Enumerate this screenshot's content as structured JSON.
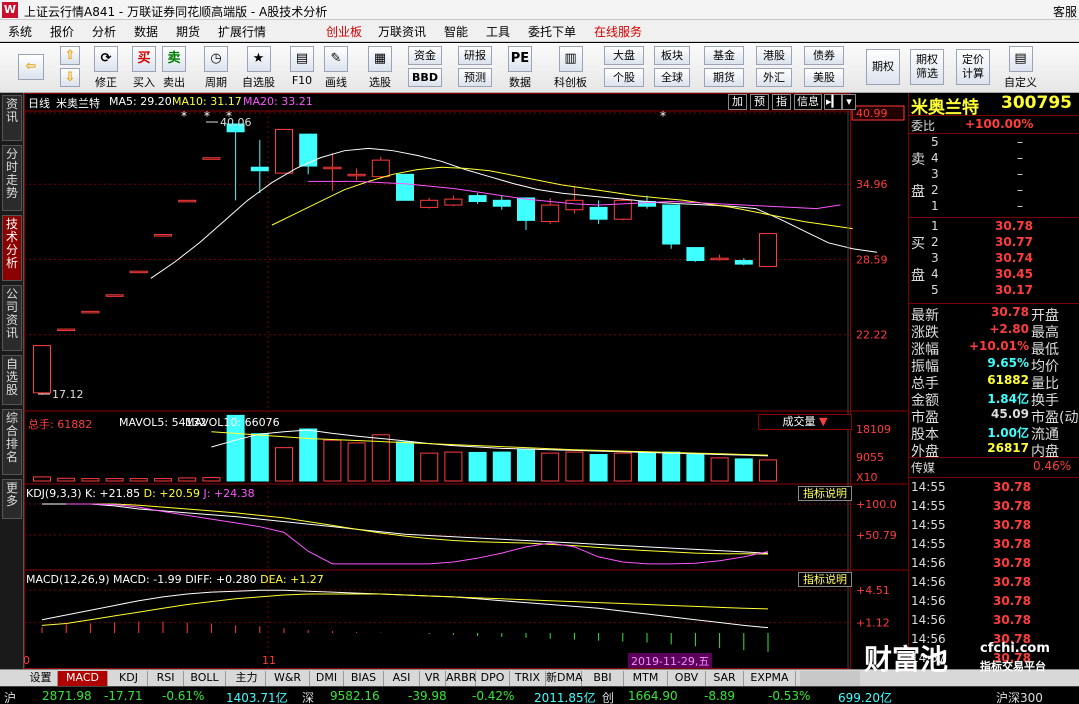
{
  "title_bar": {
    "logo": "W",
    "title": "上证云行情A841 - 万联证券同花顺高端版 - A股技术分析",
    "right_text": "客服"
  },
  "menu": [
    "系统",
    "报价",
    "分析",
    "数据",
    "期货",
    "扩展行情",
    "创业板",
    "万联资讯",
    "智能",
    "工具",
    "委托下单",
    "在线服务"
  ],
  "menu_highlight": [
    "创业板",
    "在线服务"
  ],
  "toolbar": {
    "big_buttons": [
      {
        "label": "修正",
        "icon": "refresh-icon",
        "glyph": "⟳"
      },
      {
        "label": "买入",
        "icon": "buy-icon",
        "glyph": "买"
      },
      {
        "label": "卖出",
        "icon": "sell-icon",
        "glyph": "卖"
      },
      {
        "label": "周期",
        "icon": "clock-icon",
        "glyph": "◷"
      },
      {
        "label": "自选股",
        "icon": "star-icon",
        "glyph": "★"
      },
      {
        "label": "F10",
        "icon": "f10-icon",
        "glyph": "▤"
      },
      {
        "label": "画线",
        "icon": "pencil-icon",
        "glyph": "✎"
      },
      {
        "label": "选股",
        "icon": "screen-icon",
        "glyph": "▦"
      },
      {
        "label": "数据",
        "icon": "pe-icon",
        "glyph": "PE"
      },
      {
        "label": "科创板",
        "icon": "kcb-icon",
        "glyph": "▥"
      },
      {
        "label": "期权",
        "icon": "option-icon",
        "glyph": ""
      },
      {
        "label": "期权筛选",
        "icon": "option-filter-icon",
        "glyph": ""
      },
      {
        "label": "定价计算",
        "icon": "calc-icon",
        "glyph": ""
      },
      {
        "label": "自定义",
        "icon": "custom-icon",
        "glyph": "▤"
      }
    ],
    "small_buttons": [
      "资金",
      "BBD",
      "研报",
      "预测",
      "大盘",
      "个股",
      "板块",
      "全球",
      "基金",
      "期货",
      "港股",
      "外汇",
      "债券",
      "美股"
    ]
  },
  "left_tabs": [
    "资讯",
    "分时走势",
    "技术分析",
    "公司资讯",
    "自选股",
    "综合排名",
    "更多"
  ],
  "chart": {
    "period": "日线",
    "name": "米奥兰特",
    "ma_label": [
      "MA5: 29.20",
      "MA10: 31.17",
      "MA20: 33.21"
    ],
    "ma_colors": {
      "ma5": "#ffffff",
      "ma10": "#ffff33",
      "ma20": "#ff55ff"
    },
    "up_color": "#ff3d3d",
    "down_color": "#40ffff",
    "panel_buttons": [
      "加",
      "预",
      "指",
      "信息"
    ],
    "price_axis": [
      "40.99",
      "34.96",
      "28.59",
      "22.22"
    ],
    "high_mark": "40.06",
    "low_mark": "17.12",
    "volume_header": [
      "总手: 61882",
      "MAVOL5: 54132",
      "MAVOL10: 66076"
    ],
    "volume_select": "成交量",
    "volume_axis": [
      "18109",
      "9055",
      "X10"
    ],
    "kdj_header": [
      "KDJ(9,3,3)",
      "K: +21.85",
      "D: +20.59",
      "J: +24.38"
    ],
    "kdj_axis": [
      "+100.0",
      "+50.79"
    ],
    "macd_header": [
      "MACD(12,26,9)",
      "MACD: -1.99",
      "DIFF: +0.280",
      "DEA: +1.27"
    ],
    "macd_axis": [
      "+4.51",
      "+1.12"
    ],
    "indicator_btn": "指标说明",
    "x_labels": [
      "10",
      "11"
    ],
    "date_label": "2019-11-29,五",
    "candles": [
      {
        "o": 17.3,
        "c": 21.3,
        "h": 21.3,
        "l": 17.12,
        "v": 12
      },
      {
        "o": 22.7,
        "c": 22.7,
        "h": 22.7,
        "l": 22.7,
        "v": 8
      },
      {
        "o": 24.2,
        "c": 24.2,
        "h": 24.2,
        "l": 24.2,
        "v": 7
      },
      {
        "o": 25.6,
        "c": 25.6,
        "h": 25.6,
        "l": 25.6,
        "v": 7
      },
      {
        "o": 27.6,
        "c": 27.6,
        "h": 27.6,
        "l": 27.6,
        "v": 7
      },
      {
        "o": 30.7,
        "c": 30.7,
        "h": 30.7,
        "l": 30.7,
        "v": 7
      },
      {
        "o": 33.6,
        "c": 33.6,
        "h": 33.6,
        "l": 33.6,
        "v": 9
      },
      {
        "o": 37.2,
        "c": 37.2,
        "h": 37.2,
        "l": 37.2,
        "v": 10
      },
      {
        "o": 40.06,
        "c": 39.4,
        "h": 40.06,
        "l": 33.6,
        "v": 193
      },
      {
        "o": 36.4,
        "c": 36.1,
        "h": 38.7,
        "l": 34.2,
        "v": 139
      },
      {
        "o": 35.9,
        "c": 39.6,
        "h": 39.6,
        "l": 35.9,
        "v": 98
      },
      {
        "o": 39.2,
        "c": 36.5,
        "h": 39.2,
        "l": 35.8,
        "v": 153
      },
      {
        "o": 36.4,
        "c": 36.4,
        "h": 37.6,
        "l": 34.4,
        "v": 120
      },
      {
        "o": 35.8,
        "c": 35.8,
        "h": 36.3,
        "l": 35.3,
        "v": 112
      },
      {
        "o": 35.6,
        "c": 37.0,
        "h": 37.3,
        "l": 35.4,
        "v": 136
      },
      {
        "o": 35.8,
        "c": 33.6,
        "h": 35.8,
        "l": 33.6,
        "v": 115
      },
      {
        "o": 33.0,
        "c": 33.6,
        "h": 33.8,
        "l": 32.9,
        "v": 82
      },
      {
        "o": 33.2,
        "c": 33.7,
        "h": 34.0,
        "l": 33.1,
        "v": 85
      },
      {
        "o": 34.0,
        "c": 33.5,
        "h": 34.2,
        "l": 33.3,
        "v": 84
      },
      {
        "o": 33.6,
        "c": 33.1,
        "h": 34.0,
        "l": 32.8,
        "v": 85
      },
      {
        "o": 33.8,
        "c": 31.9,
        "h": 33.8,
        "l": 31.1,
        "v": 93
      },
      {
        "o": 31.8,
        "c": 33.2,
        "h": 33.8,
        "l": 31.6,
        "v": 82
      },
      {
        "o": 32.8,
        "c": 33.6,
        "h": 34.8,
        "l": 32.5,
        "v": 85
      },
      {
        "o": 33.0,
        "c": 32.0,
        "h": 33.6,
        "l": 31.6,
        "v": 78
      },
      {
        "o": 32.0,
        "c": 33.6,
        "h": 33.8,
        "l": 31.9,
        "v": 82
      },
      {
        "o": 33.5,
        "c": 33.1,
        "h": 34.0,
        "l": 32.9,
        "v": 85
      },
      {
        "o": 33.2,
        "c": 29.9,
        "h": 33.2,
        "l": 29.5,
        "v": 85
      },
      {
        "o": 29.6,
        "c": 28.5,
        "h": 29.6,
        "l": 28.4,
        "v": 78
      },
      {
        "o": 28.7,
        "c": 28.7,
        "h": 29.0,
        "l": 28.5,
        "v": 68
      },
      {
        "o": 28.5,
        "c": 28.2,
        "h": 28.7,
        "l": 28.1,
        "v": 65
      },
      {
        "o": 28.0,
        "c": 30.78,
        "h": 30.78,
        "l": 28.0,
        "v": 62
      }
    ],
    "ma5_line": [
      27.0,
      28.4,
      30.0,
      31.8,
      33.6,
      35.1,
      36.3,
      37.2,
      37.8,
      38.0,
      37.8,
      37.4,
      36.9,
      36.2,
      35.6,
      35.0,
      34.5,
      34.2,
      34.0,
      33.8,
      33.6,
      33.4,
      33.3,
      33.2,
      33.1,
      32.9,
      32.0,
      31.0,
      30.0,
      29.5,
      29.2
    ],
    "ma10_line": [
      31.5,
      32.5,
      33.5,
      34.5,
      35.2,
      35.8,
      36.2,
      36.4,
      36.3,
      36.1,
      35.7,
      35.3,
      34.9,
      34.6,
      34.3,
      34.0,
      33.8,
      33.6,
      33.3,
      33.0,
      32.6,
      32.2,
      31.8,
      31.5,
      31.2
    ],
    "ma20_line": [
      35.2,
      35.2,
      35.2,
      35.1,
      35.0,
      34.8,
      34.6,
      34.3,
      34.0,
      33.7,
      33.5,
      33.3,
      33.2,
      33.3,
      33.4,
      33.5,
      33.4,
      33.3,
      33.2,
      33.1,
      33.0,
      32.9,
      33.21
    ],
    "mavol5_line": [
      100,
      120,
      138,
      145,
      150,
      140,
      132,
      125,
      118,
      110,
      104,
      100,
      96,
      94,
      92,
      90,
      88,
      86,
      84,
      82,
      80,
      78,
      76,
      74
    ],
    "mavol10_line": [
      145,
      140,
      135,
      130,
      125,
      122,
      119,
      116,
      113,
      110,
      107,
      104,
      101,
      98,
      95,
      92,
      90,
      88,
      86,
      84,
      82,
      80,
      78,
      76
    ],
    "kdj_k": [
      100,
      100,
      100,
      97,
      92,
      89,
      86,
      83,
      80,
      76,
      72,
      68,
      64,
      60,
      56,
      52,
      50,
      48,
      46,
      44,
      42,
      40,
      38,
      36,
      34,
      32,
      30,
      28,
      26,
      24,
      21.85
    ],
    "kdj_d": [
      100,
      100,
      100,
      98,
      95,
      92,
      89,
      86,
      82,
      78,
      72,
      66,
      60,
      54,
      49,
      45,
      42,
      40,
      39,
      38,
      36,
      34,
      31,
      28,
      26,
      24,
      22,
      21,
      21,
      20.59
    ],
    "kdj_j": [
      100,
      100,
      99,
      95,
      88,
      82,
      76,
      70,
      64,
      55,
      25,
      5,
      5,
      5,
      5,
      5,
      8,
      14,
      22,
      32,
      38,
      32,
      16,
      8,
      5,
      5,
      6,
      10,
      16,
      24.38
    ],
    "macd_diff": [
      0.7,
      0.95,
      1.2,
      1.45,
      1.7,
      1.9,
      2.05,
      2.15,
      2.2,
      2.25,
      2.25,
      2.2,
      2.15,
      2.1,
      2.05,
      2.0,
      1.95,
      1.9,
      1.8,
      1.7,
      1.6,
      1.5,
      1.4,
      1.3,
      1.15,
      1.0,
      0.85,
      0.7,
      0.55,
      0.4,
      0.28
    ],
    "macd_dea": [
      0.4,
      0.5,
      0.7,
      0.9,
      1.1,
      1.3,
      1.5,
      1.65,
      1.8,
      1.9,
      2.0,
      2.05,
      2.05,
      2.05,
      2.05,
      2.0,
      1.95,
      1.9,
      1.85,
      1.8,
      1.75,
      1.7,
      1.65,
      1.6,
      1.55,
      1.5,
      1.45,
      1.4,
      1.35,
      1.3,
      1.27
    ],
    "macd_bar": [
      0.6,
      0.9,
      1.0,
      1.1,
      1.2,
      1.2,
      1.1,
      1.0,
      0.8,
      0.7,
      0.5,
      0.3,
      0.2,
      0.1,
      0.05,
      0.0,
      -0.1,
      -0.2,
      -0.3,
      -0.4,
      -0.5,
      -0.6,
      -0.7,
      -0.8,
      -0.9,
      -1.0,
      -1.2,
      -1.4,
      -1.6,
      -1.8,
      -1.99
    ]
  },
  "quote": {
    "name": "米奥兰特",
    "code": "300795",
    "weibi_label": "委比",
    "weibi_value": "+100.00%",
    "sell_label": [
      "卖",
      "盘"
    ],
    "buy_label": [
      "买",
      "盘"
    ],
    "sell": [
      [
        "5",
        "–"
      ],
      [
        "4",
        "–"
      ],
      [
        "3",
        "–"
      ],
      [
        "2",
        "–"
      ],
      [
        "1",
        "–"
      ]
    ],
    "buy": [
      [
        "1",
        "30.78"
      ],
      [
        "2",
        "30.77"
      ],
      [
        "3",
        "30.74"
      ],
      [
        "4",
        "30.45"
      ],
      [
        "5",
        "30.17"
      ]
    ],
    "stats": [
      [
        "最新",
        "30.78",
        "开盘"
      ],
      [
        "涨跌",
        "+2.80",
        "最高"
      ],
      [
        "涨幅",
        "+10.01%",
        "最低"
      ],
      [
        "振幅",
        "9.65%",
        "均价"
      ],
      [
        "总手",
        "61882",
        "量比"
      ],
      [
        "金额",
        "1.84亿",
        "换手"
      ],
      [
        "市盈",
        "45.09",
        "市盈(动)"
      ],
      [
        "股本",
        "1.00亿",
        "流通"
      ],
      [
        "外盘",
        "26817",
        "内盘"
      ]
    ],
    "sector": "传媒",
    "sector_pct": "0.46%",
    "ticks": [
      [
        "14:55",
        "30.78"
      ],
      [
        "14:55",
        "30.78"
      ],
      [
        "14:55",
        "30.78"
      ],
      [
        "14:55",
        "30.78"
      ],
      [
        "14:56",
        "30.78"
      ],
      [
        "14:56",
        "30.78"
      ],
      [
        "14:56",
        "30.78"
      ],
      [
        "14:56",
        "30.78"
      ],
      [
        "14:56",
        "30.78"
      ],
      [
        "14:57",
        "30.78"
      ]
    ]
  },
  "bottom_tabs": [
    "设置",
    "MACD",
    "KDJ",
    "RSI",
    "BOLL",
    "主力",
    "W&R",
    "DMI",
    "BIAS",
    "ASI",
    "VR",
    "ARBR",
    "DPO",
    "TRIX",
    "新DMA",
    "BBI",
    "MTM",
    "OBV",
    "SAR",
    "EXPMA"
  ],
  "bottom_active": "MACD",
  "status": [
    {
      "t": "沪",
      "c": "#dddddd"
    },
    {
      "t": "2871.98",
      "c": "#35e535"
    },
    {
      "t": "-17.71",
      "c": "#35e535"
    },
    {
      "t": "-0.61%",
      "c": "#35e535"
    },
    {
      "t": "1403.71亿",
      "c": "#40ffff"
    },
    {
      "t": "深",
      "c": "#dddddd"
    },
    {
      "t": "9582.16",
      "c": "#35e535"
    },
    {
      "t": "-39.98",
      "c": "#35e535"
    },
    {
      "t": "-0.42%",
      "c": "#35e535"
    },
    {
      "t": "2011.85亿",
      "c": "#40ffff"
    },
    {
      "t": "创",
      "c": "#dddddd"
    },
    {
      "t": "1664.90",
      "c": "#35e535"
    },
    {
      "t": "-8.89",
      "c": "#35e535"
    },
    {
      "t": "-0.53%",
      "c": "#35e535"
    },
    {
      "t": "699.20亿",
      "c": "#40ffff"
    },
    {
      "t": "沪深300",
      "c": "#dddddd"
    }
  ],
  "watermark": {
    "brand": "财富池",
    "site": "cfchi.com",
    "slogan": "指标交易平台"
  }
}
